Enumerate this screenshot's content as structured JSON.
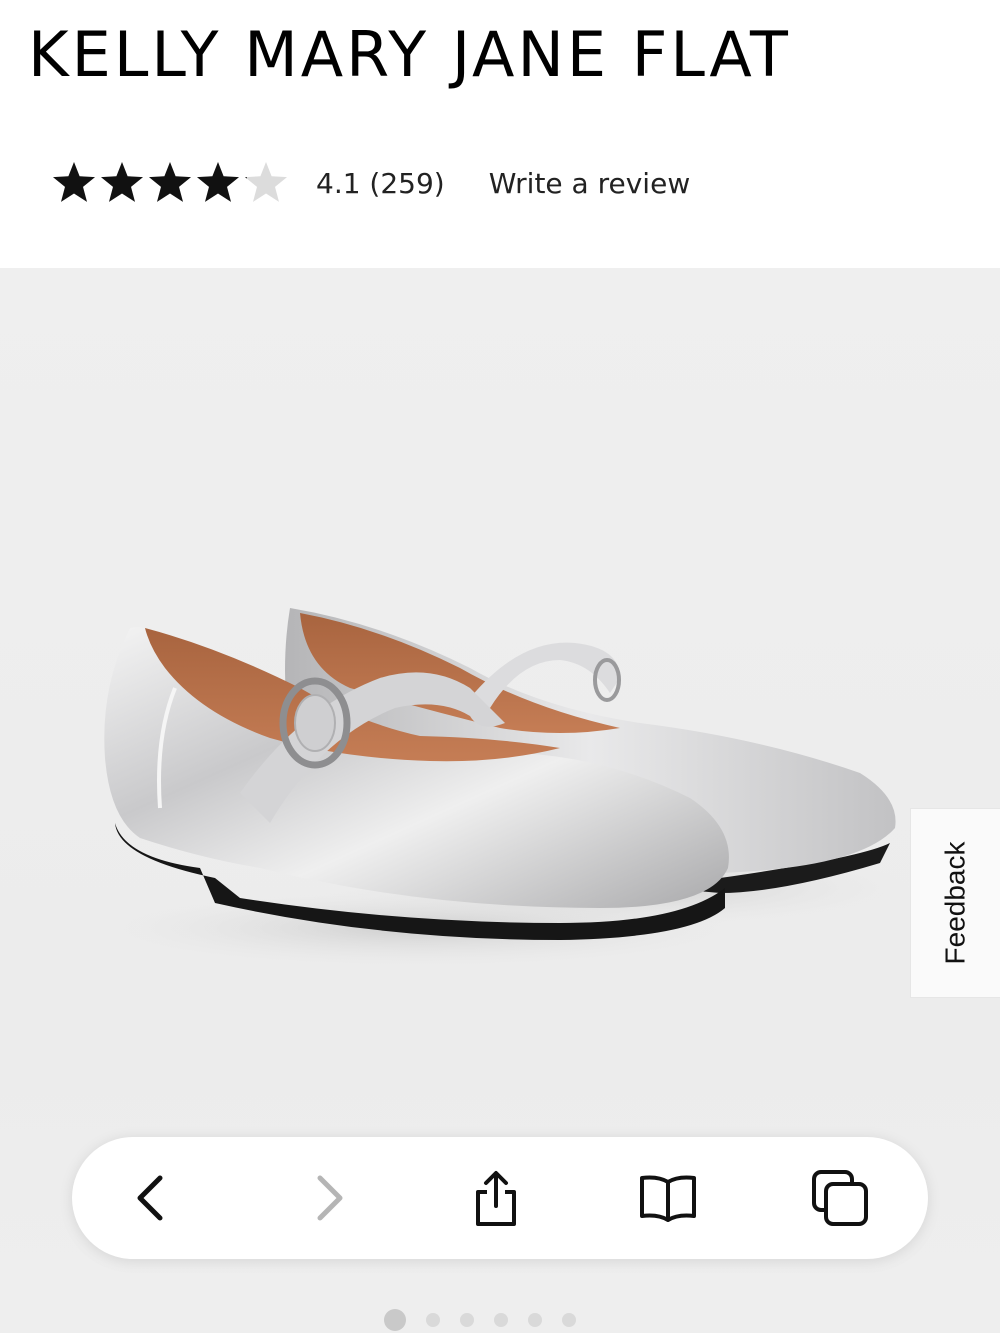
{
  "product": {
    "title": "KELLY MARY JANE FLAT",
    "rating": {
      "value": 4.1,
      "max": 5,
      "text": "4.1 (259)",
      "write_review_label": "Write a review"
    }
  },
  "gallery": {
    "feedback_label": "Feedback",
    "current_slide": 1,
    "total_slides": 6
  },
  "browser_toolbar": {
    "buttons": [
      {
        "icon": "chevron-left-icon",
        "enabled": true
      },
      {
        "icon": "chevron-right-icon",
        "enabled": false
      },
      {
        "icon": "share-icon",
        "enabled": true
      },
      {
        "icon": "bookmarks-icon",
        "enabled": true
      },
      {
        "icon": "tabs-icon",
        "enabled": true
      }
    ]
  },
  "colors": {
    "text": "#000000",
    "star_filled": "#111111",
    "star_empty": "#dcdcdc",
    "gallery_bg": "#eeeeee",
    "toolbar_bg": "#ffffff",
    "disabled_icon": "#b5b5b5"
  }
}
